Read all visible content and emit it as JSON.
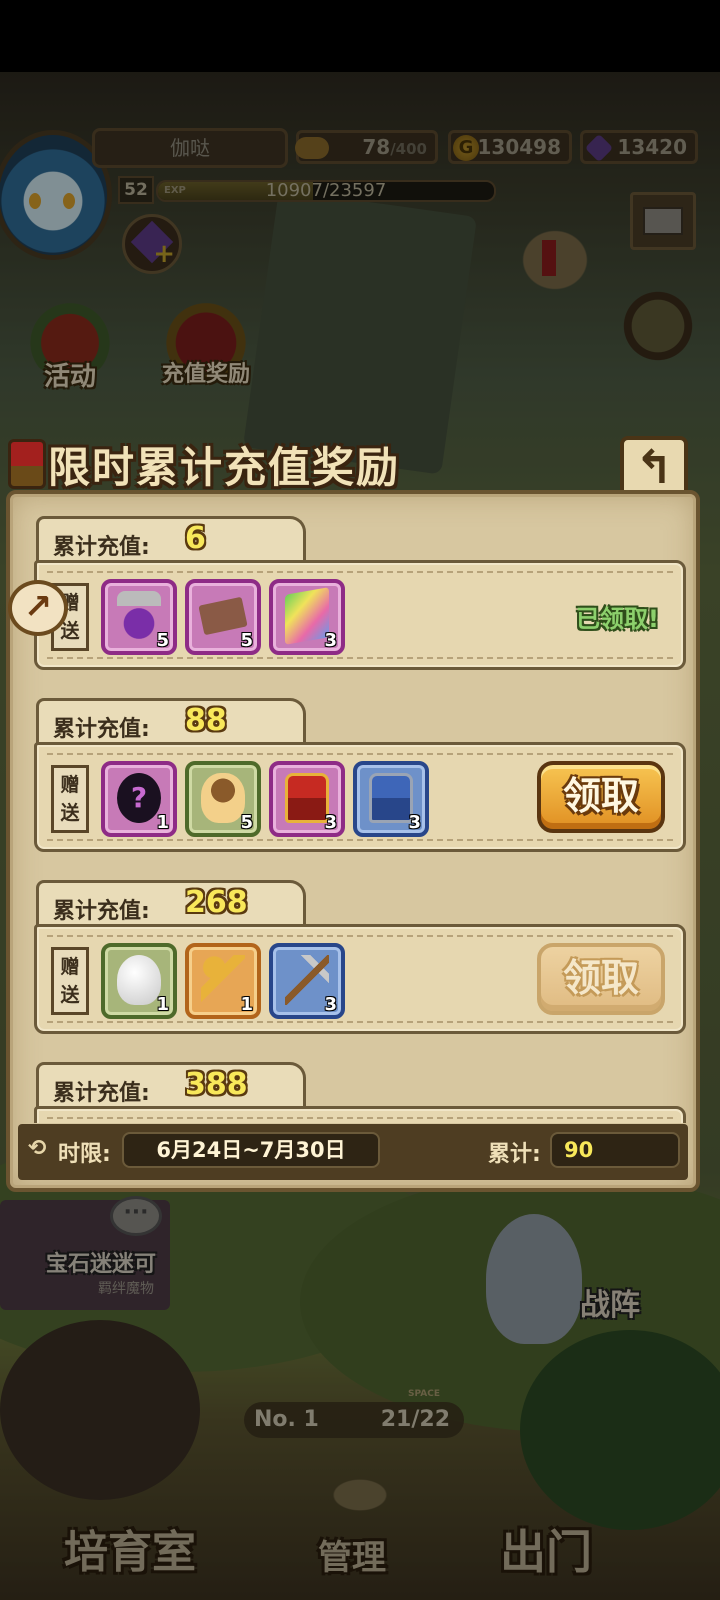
{
  "hud": {
    "player_name": "伽哒",
    "level": "52",
    "exp_tag": "EXP",
    "exp_text": "10907/23597",
    "exp_fraction": 0.462,
    "stamina": "78",
    "stamina_max": "/400",
    "gold_symbol": "G",
    "gold": "130498",
    "gems": "13420",
    "gem_add": "+"
  },
  "menu": {
    "event_label": "活动",
    "recharge_label": "充值奖励"
  },
  "modal": {
    "title": "限时累计充值奖励",
    "back_icon": "↰",
    "side_marker": "↗",
    "tiers": [
      {
        "label": "累计充值:",
        "amount": "6",
        "gift_label": "赠送",
        "items": [
          {
            "icon": "potion-icon",
            "count": "5",
            "rarity": "purple"
          },
          {
            "icon": "ticket-icon",
            "count": "5",
            "rarity": "purple"
          },
          {
            "icon": "rainbow-book-icon",
            "count": "3",
            "rarity": "purple"
          }
        ],
        "status": "已领取!"
      },
      {
        "label": "累计充值:",
        "amount": "88",
        "gift_label": "赠送",
        "items": [
          {
            "icon": "mystery-monster-icon",
            "count": "1",
            "rarity": "purple",
            "glyph": "?"
          },
          {
            "icon": "pudding-egg-icon",
            "count": "5",
            "rarity": "green"
          },
          {
            "icon": "red-chest-icon",
            "count": "3",
            "rarity": "purple"
          },
          {
            "icon": "blue-chest-icon",
            "count": "3",
            "rarity": "blue"
          }
        ],
        "button": "领取"
      },
      {
        "label": "累计充值:",
        "amount": "268",
        "gift_label": "赠送",
        "items": [
          {
            "icon": "white-egg-icon",
            "count": "1",
            "rarity": "green"
          },
          {
            "icon": "golden-key-icon",
            "count": "1",
            "rarity": "orange"
          },
          {
            "icon": "pickaxe-icon",
            "count": "3",
            "rarity": "blue"
          }
        ],
        "button": "领取"
      },
      {
        "label": "累计充值:",
        "amount": "388"
      }
    ],
    "footer": {
      "period_label": "时限:",
      "period": "6月24日~7月30日",
      "total_label": "累计:",
      "total": "90"
    }
  },
  "scene": {
    "monster_name": "宝石迷迷可",
    "monster_sub": "羁绊魔物",
    "bubble": "···",
    "formation": "战阵",
    "rank": "No. 1",
    "capacity": "21/22",
    "capacity_tag": "SPACE",
    "nav_breed": "培育室",
    "nav_manage": "管理",
    "nav_out": "出门"
  }
}
